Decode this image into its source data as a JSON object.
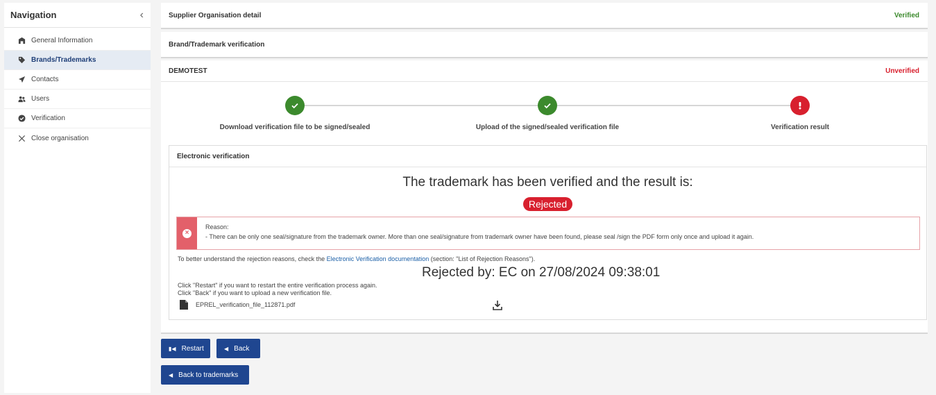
{
  "sidebar": {
    "title": "Navigation",
    "collapse_icon": "chevron-left-icon",
    "items": [
      {
        "label": "General Information",
        "icon": "building-icon",
        "active": false
      },
      {
        "label": "Brands/Trademarks",
        "icon": "tag-icon",
        "active": true
      },
      {
        "label": "Contacts",
        "icon": "paper-plane-icon",
        "active": false
      },
      {
        "label": "Users",
        "icon": "users-icon",
        "active": false
      },
      {
        "label": "Verification",
        "icon": "check-circle-icon",
        "active": false
      },
      {
        "label": "Close organisation",
        "icon": "close-icon",
        "active": false
      }
    ]
  },
  "panels": {
    "supplier": {
      "title": "Supplier Organisation detail",
      "status": "Verified"
    },
    "brand": {
      "title": "Brand/Trademark verification"
    },
    "demotest": {
      "title": "DEMOTEST",
      "status": "Unverified"
    }
  },
  "stepper": {
    "steps": [
      {
        "label": "Download verification file to be signed/sealed",
        "state": "done"
      },
      {
        "label": "Upload of the signed/sealed verification file",
        "state": "done"
      },
      {
        "label": "Verification result",
        "state": "error"
      }
    ]
  },
  "verification": {
    "card_title": "Electronic verification",
    "result_heading": "The trademark has been verified and the result is:",
    "result_badge": "Rejected",
    "reason_title": "Reason:",
    "reason_text": "-   There can be only one seal/signature from the trademark owner. More than one seal/signature from trademark owner have been found, please seal /sign the PDF form only once and upload it again.",
    "help_prefix": "To better understand the rejection reasons, check the ",
    "help_link": "Electronic Verification documentation",
    "help_suffix": " (section: \"List of Rejection Reasons\").",
    "rejected_by": "Rejected by: EC on 27/08/2024 09:38:01",
    "hint_restart": "Click \"Restart\" if you want to restart the entire verification process again.",
    "hint_back": "Click \"Back\" if you want to upload a new verification file.",
    "file_name": "EPREL_verification_file_112871.pdf"
  },
  "buttons": {
    "restart": "Restart",
    "back": "Back",
    "back_to_trademarks": "Back to trademarks"
  },
  "colors": {
    "primary": "#1f4690",
    "success": "#3c8a2d",
    "danger": "#d8202e",
    "active_nav_bg": "#e5ebf3"
  }
}
